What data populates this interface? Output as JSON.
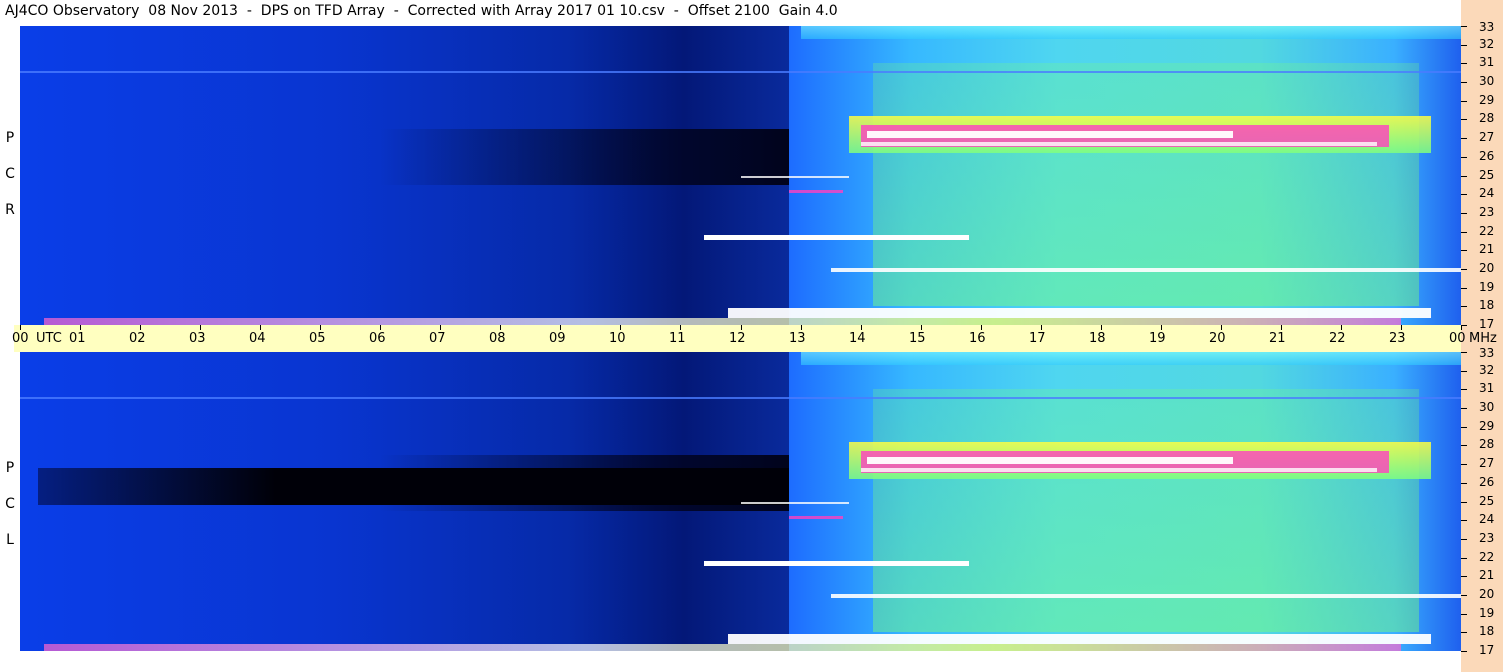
{
  "title": "AJ4CO Observatory  08 Nov 2013  -  DPS on TFD Array  -  Corrected with Array 2017 01 10.csv  -  Offset 2100  Gain 4.0",
  "chart_data": {
    "type": "heatmap",
    "panels": [
      {
        "name": "RCP",
        "letters": [
          "P",
          "C",
          "R"
        ]
      },
      {
        "name": "LCP",
        "letters": [
          "P",
          "C",
          "L"
        ]
      }
    ],
    "x_axis": {
      "unit_label": "UTC",
      "ticks": [
        "00",
        "01",
        "02",
        "03",
        "04",
        "05",
        "06",
        "07",
        "08",
        "09",
        "10",
        "11",
        "12",
        "13",
        "14",
        "15",
        "16",
        "17",
        "18",
        "19",
        "20",
        "21",
        "22",
        "23",
        "00"
      ],
      "range": [
        0,
        24
      ]
    },
    "y_axis": {
      "unit_label": "MHz",
      "ticks": [
        "33",
        "32",
        "31",
        "30",
        "29",
        "28",
        "27",
        "26",
        "25",
        "24",
        "23",
        "22",
        "21",
        "20",
        "19",
        "18",
        "17"
      ],
      "range": [
        17,
        33
      ]
    },
    "colors": {
      "background": "#0d3ce0",
      "night_dark": "#000000",
      "quiet": "#1a52ff",
      "active_cyan": "#33ccff",
      "active_green": "#7fff7f",
      "active_yellow": "#ffff40",
      "intense_magenta": "#ff40c0",
      "saturated": "#ffffff"
    }
  }
}
